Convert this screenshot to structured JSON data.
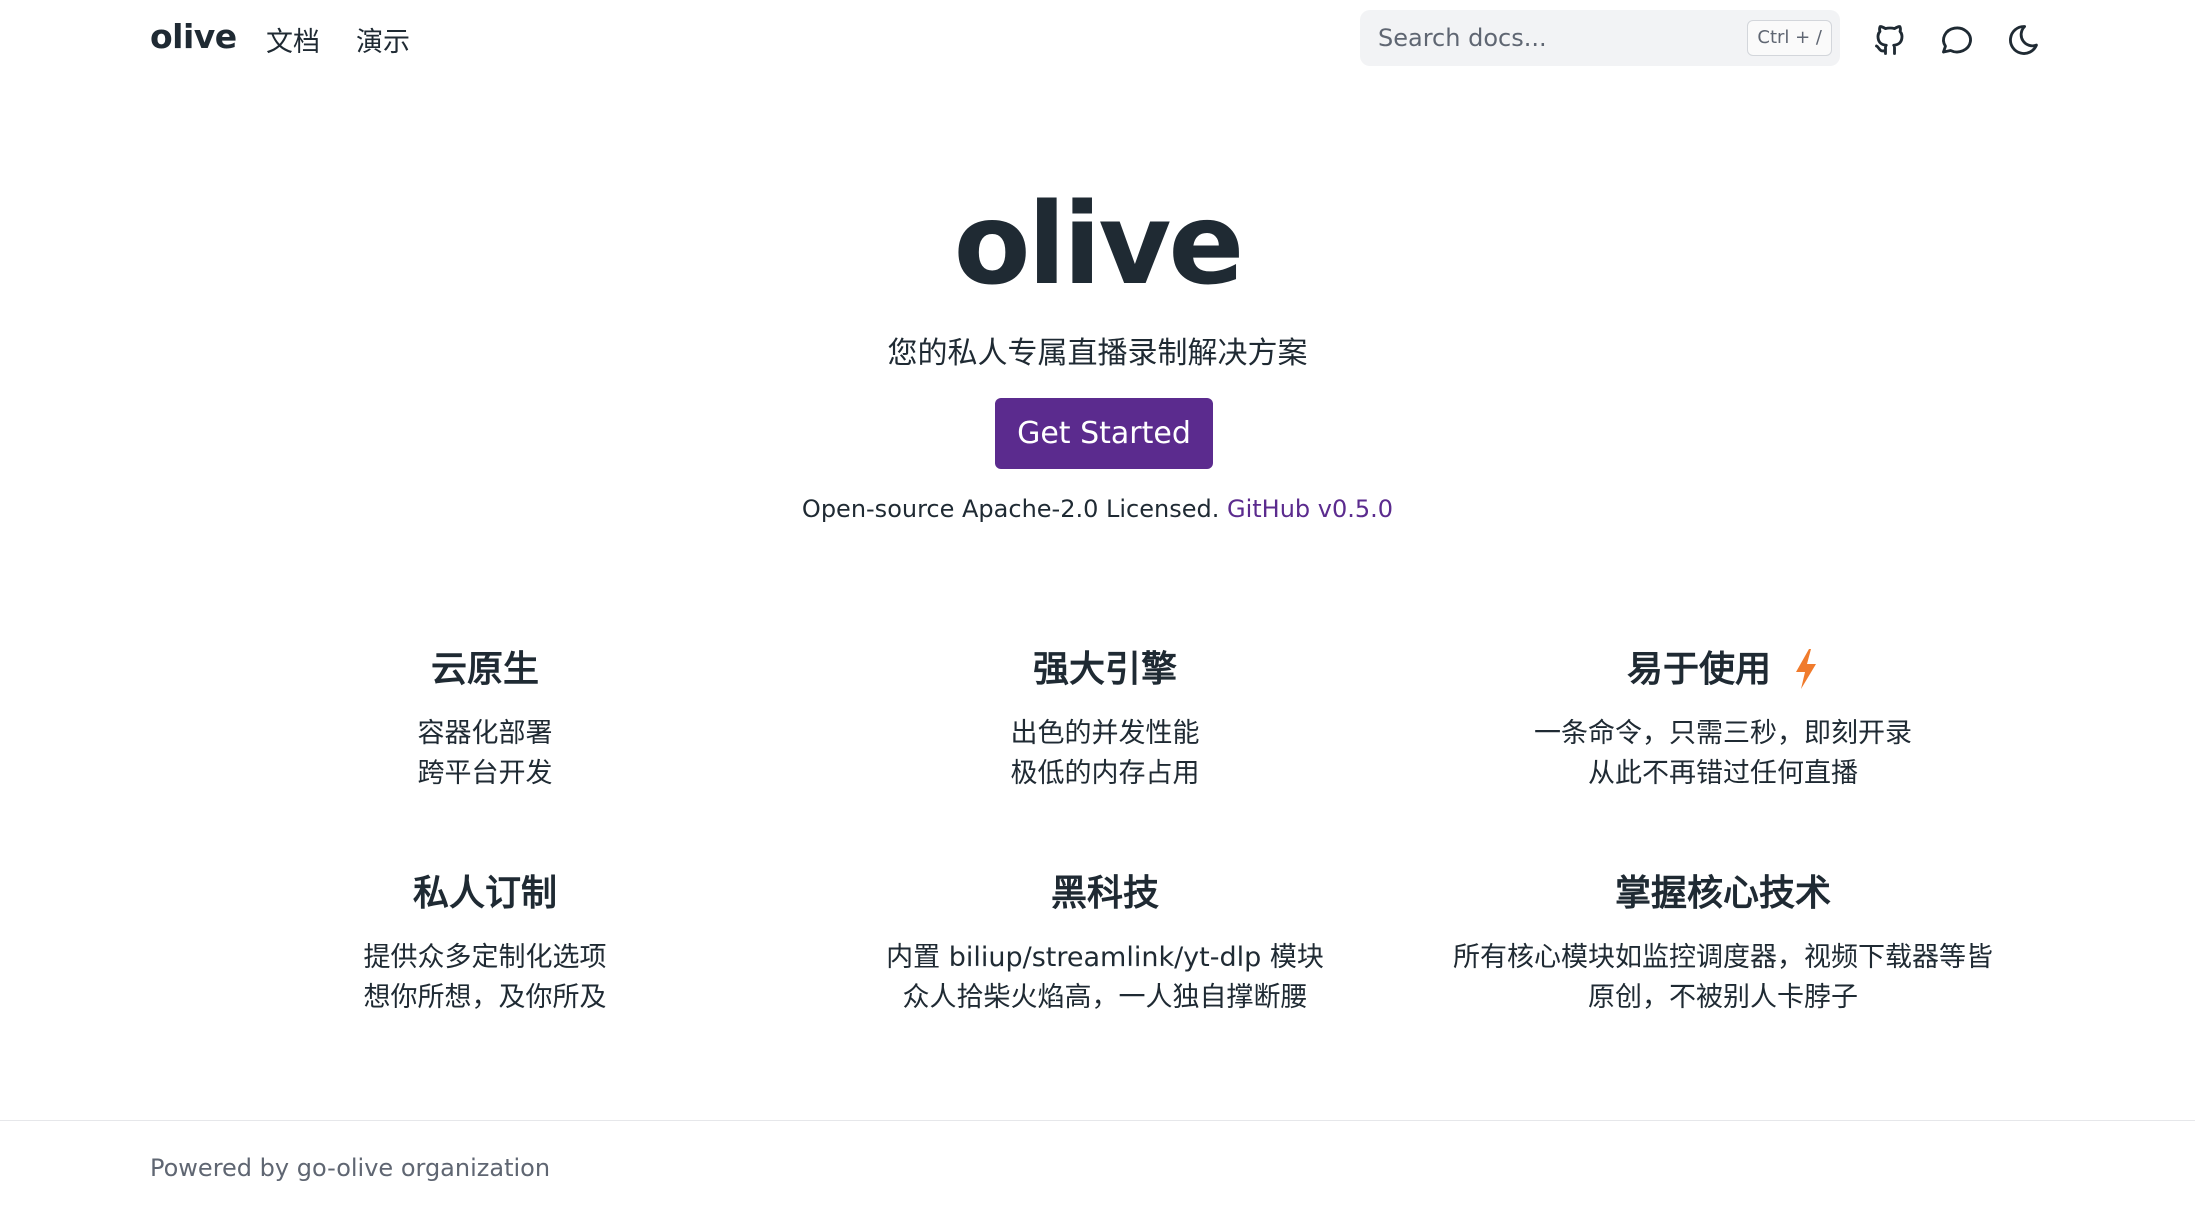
{
  "nav": {
    "brand": "olive",
    "links": [
      "文档",
      "演示"
    ],
    "search": {
      "placeholder": "Search docs...",
      "shortcut": "Ctrl + /"
    },
    "icons": [
      "github-icon",
      "discussion-icon",
      "moon-icon"
    ]
  },
  "hero": {
    "title": "olive",
    "subtitle": "您的私人专属直播录制解决方案",
    "cta_label": "Get Started",
    "license_text": "Open-source Apache-2.0 Licensed.",
    "version_link": "GitHub v0.5.0"
  },
  "features": [
    {
      "title": "云原生",
      "lines": [
        "容器化部署",
        "跨平台开发"
      ]
    },
    {
      "title": "强大引擎",
      "lines": [
        "出色的并发性能",
        "极低的内存占用"
      ]
    },
    {
      "title": "易于使用",
      "icon": "lightning-icon",
      "lines": [
        "一条命令，只需三秒，即刻开录",
        "从此不再错过任何直播"
      ]
    },
    {
      "title": "私人订制",
      "lines": [
        "提供众多定制化选项",
        "想你所想，及你所及"
      ]
    },
    {
      "title": "黑科技",
      "lines": [
        "内置 biliup/streamlink/yt-dlp 模块",
        "众人拾柴火焰高，一人独自撑断腰"
      ]
    },
    {
      "title": "掌握核心技术",
      "lines": [
        "所有核心模块如监控调度器，视频下载器等皆",
        "原创，不被别人卡脖子"
      ]
    }
  ],
  "footer": {
    "text": "Powered by go-olive organization"
  },
  "colors": {
    "accent": "#5b2b8e",
    "text": "#1f2a33",
    "bolt": "#f07b2c"
  }
}
